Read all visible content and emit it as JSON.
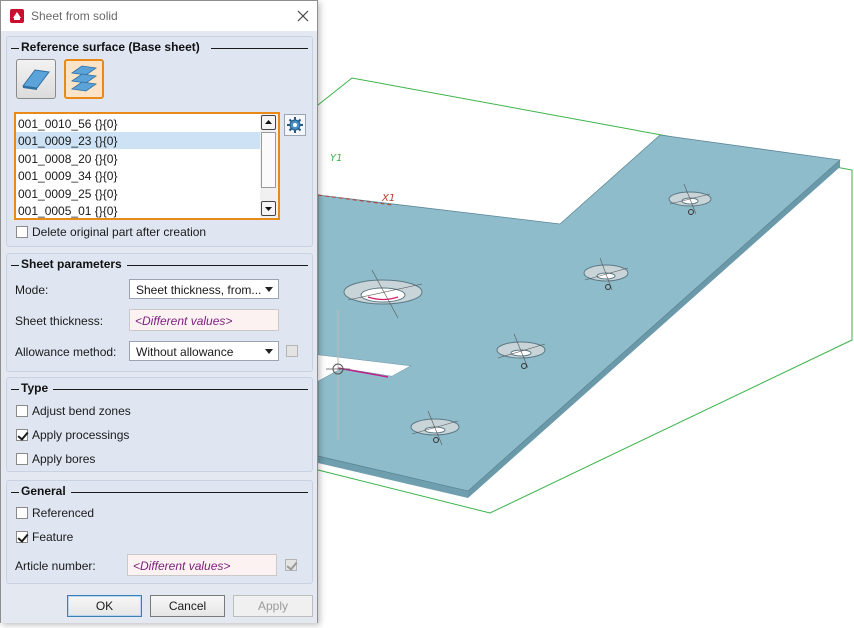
{
  "dialog": {
    "title": "Sheet from solid",
    "close_icon": "close-icon"
  },
  "reference_surface": {
    "title": "Reference surface (Base sheet)",
    "list_items": [
      "001_0010_56 {}{0}",
      "001_0009_23 {}{0}",
      "001_0008_20 {}{0}",
      "001_0009_34 {}{0}",
      "001_0009_25 {}{0}",
      "001_0005_01 {}{0}"
    ],
    "selected_index": 1,
    "delete_original_label": "Delete original part after creation",
    "delete_original_checked": false
  },
  "sheet_parameters": {
    "title": "Sheet parameters",
    "mode_label": "Mode:",
    "mode_value": "Sheet thickness, from...",
    "thickness_label": "Sheet thickness:",
    "thickness_value": "<Different values>",
    "allowance_label": "Allowance method:",
    "allowance_value": "Without allowance",
    "allowance_checked": false
  },
  "type": {
    "title": "Type",
    "adjust_bend_label": "Adjust bend zones",
    "adjust_bend_checked": false,
    "apply_processings_label": "Apply processings",
    "apply_processings_checked": true,
    "apply_bores_label": "Apply bores",
    "apply_bores_checked": false
  },
  "general": {
    "title": "General",
    "referenced_label": "Referenced",
    "referenced_checked": false,
    "feature_label": "Feature",
    "feature_checked": true,
    "article_label": "Article number:",
    "article_value": "<Different values>",
    "article_checked": true
  },
  "buttons": {
    "ok": "OK",
    "cancel": "Cancel",
    "apply": "Apply"
  },
  "viewport": {
    "axis_y_label": "Y1",
    "axis_x_label": "X1",
    "sheet_color": "#8fbccb",
    "grid_color": "#3cb34a"
  }
}
